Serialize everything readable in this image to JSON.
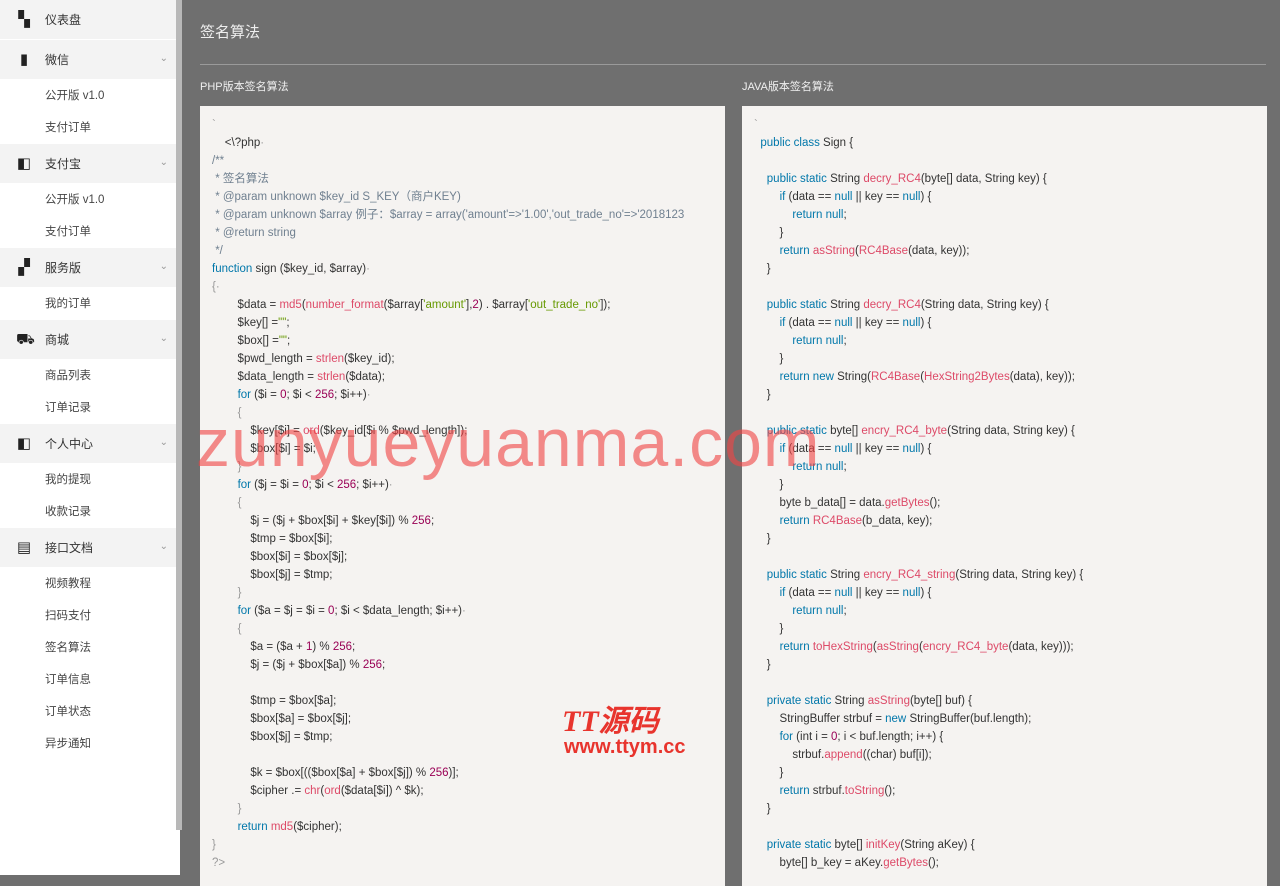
{
  "sidebar": {
    "items": [
      {
        "label": "仪表盘",
        "icon": "dashboard-icon",
        "glyph": "▚",
        "expandable": false
      },
      {
        "label": "微信",
        "icon": "wechat-icon",
        "glyph": "▮",
        "expandable": true
      },
      {
        "label": "公开版 v1.0",
        "sub": true
      },
      {
        "label": "支付订单",
        "sub": true
      },
      {
        "label": "支付宝",
        "icon": "wallet-icon",
        "glyph": "◧",
        "expandable": true
      },
      {
        "label": "公开版 v1.0",
        "sub": true
      },
      {
        "label": "支付订单",
        "sub": true
      },
      {
        "label": "服务版",
        "icon": "grid-icon",
        "glyph": "▞",
        "expandable": true
      },
      {
        "label": "我的订单",
        "sub": true
      },
      {
        "label": "商城",
        "icon": "cart-icon",
        "glyph": "⛟",
        "expandable": true
      },
      {
        "label": "商品列表",
        "sub": true
      },
      {
        "label": "订单记录",
        "sub": true
      },
      {
        "label": "个人中心",
        "icon": "wallet-icon",
        "glyph": "◧",
        "expandable": true
      },
      {
        "label": "我的提现",
        "sub": true
      },
      {
        "label": "收款记录",
        "sub": true
      },
      {
        "label": "接口文档",
        "icon": "docs-icon",
        "glyph": "▤",
        "expandable": true
      },
      {
        "label": "视频教程",
        "sub": true
      },
      {
        "label": "扫码支付",
        "sub": true
      },
      {
        "label": "签名算法",
        "sub": true
      },
      {
        "label": "订单信息",
        "sub": true
      },
      {
        "label": "订单状态",
        "sub": true
      },
      {
        "label": "异步通知",
        "sub": true
      }
    ]
  },
  "page": {
    "title": "签名算法",
    "php_title": "PHP版本签名算法",
    "java_title": "JAVA版本签名算法"
  },
  "php_code": [
    "<span class=\"p\">`</span>",
    "    <\\?php<span class=\"p\">·</span>",
    "<span class=\"c\">/**</span>",
    "<span class=\"c\"> * 签名算法</span>",
    "<span class=\"c\"> * @param unknown $key_id S_KEY（商户KEY)</span>",
    "<span class=\"c\"> * @param unknown $array 例子：$array = array('amount'=>'1.00','out_trade_no'=>'2018123</span>",
    "<span class=\"c\"> * @return string</span>",
    "<span class=\"c\"> */</span>",
    "<span class=\"k\">function</span> sign ($key_id, $array)<span class=\"p\">·</span>",
    "<span class=\"p\">{·</span>",
    "        $data = <span class=\"f\">md5</span>(<span class=\"f\">number_format</span>($array[<span class=\"s\">'amount'</span>],<span class=\"n\">2</span>) . $array[<span class=\"s\">'out_trade_no'</span>]);",
    "        $key[] =<span class=\"s\">\"\"</span>;",
    "        $box[] =<span class=\"s\">\"\"</span>;",
    "        $pwd_length = <span class=\"f\">strlen</span>($key_id);",
    "        $data_length = <span class=\"f\">strlen</span>($data);",
    "        <span class=\"k\">for</span> ($i = <span class=\"n\">0</span>; $i &lt; <span class=\"n\">256</span>; $i++)<span class=\"p\">·</span>",
    "        <span class=\"p\">{</span>",
    "            $key[$i] = <span class=\"f\">ord</span>($key_id[$i % $pwd_length]);",
    "            $box[$i] = $i;",
    "        <span class=\"p\">}</span>",
    "        <span class=\"k\">for</span> ($j = $i = <span class=\"n\">0</span>; $i &lt; <span class=\"n\">256</span>; $i++)<span class=\"p\">·</span>",
    "        <span class=\"p\">{</span>",
    "            $j = ($j + $box[$i] + $key[$i]) % <span class=\"n\">256</span>;",
    "            $tmp = $box[$i];",
    "            $box[$i] = $box[$j];",
    "            $box[$j] = $tmp;",
    "        <span class=\"p\">}</span>",
    "        <span class=\"k\">for</span> ($a = $j = $i = <span class=\"n\">0</span>; $i &lt; $data_length; $i++)<span class=\"p\">·</span>",
    "        <span class=\"p\">{</span>",
    "            $a = ($a + <span class=\"n\">1</span>) % <span class=\"n\">256</span>;",
    "            $j = ($j + $box[$a]) % <span class=\"n\">256</span>;",
    "",
    "            $tmp = $box[$a];",
    "            $box[$a] = $box[$j];",
    "            $box[$j] = $tmp;",
    "",
    "            $k = $box[(($box[$a] + $box[$j]) % <span class=\"n\">256</span>)];",
    "            $cipher .= <span class=\"f\">chr</span>(<span class=\"f\">ord</span>($data[$i]) ^ $k);",
    "        <span class=\"p\">}</span>",
    "        <span class=\"k\">return</span> <span class=\"f\">md5</span>($cipher);",
    "<span class=\"p\">}</span>",
    "<span class=\"p\">?&gt;</span>"
  ],
  "java_code": [
    "<span class=\"p\">`</span>",
    "  <span class=\"k\">public class</span> Sign {",
    "",
    "    <span class=\"k\">public static</span> String <span class=\"f\">decry_RC4</span>(byte[] data, String key) {",
    "        <span class=\"k\">if</span> (data == <span class=\"k\">null</span> || key == <span class=\"k\">null</span>) {",
    "            <span class=\"k\">return null</span>;",
    "        }",
    "        <span class=\"k\">return</span> <span class=\"f\">asString</span>(<span class=\"f\">RC4Base</span>(data, key));",
    "    }",
    "",
    "    <span class=\"k\">public static</span> String <span class=\"f\">decry_RC4</span>(String data, String key) {",
    "        <span class=\"k\">if</span> (data == <span class=\"k\">null</span> || key == <span class=\"k\">null</span>) {",
    "            <span class=\"k\">return null</span>;",
    "        }",
    "        <span class=\"k\">return new</span> String(<span class=\"f\">RC4Base</span>(<span class=\"f\">HexString2Bytes</span>(data), key));",
    "    }",
    "",
    "    <span class=\"k\">public static</span> byte[] <span class=\"f\">encry_RC4_byte</span>(String data, String key) {",
    "        <span class=\"k\">if</span> (data == <span class=\"k\">null</span> || key == <span class=\"k\">null</span>) {",
    "            <span class=\"k\">return null</span>;",
    "        }",
    "        byte b_data[] = data.<span class=\"f\">getBytes</span>();",
    "        <span class=\"k\">return</span> <span class=\"f\">RC4Base</span>(b_data, key);",
    "    }",
    "",
    "    <span class=\"k\">public static</span> String <span class=\"f\">encry_RC4_string</span>(String data, String key) {",
    "        <span class=\"k\">if</span> (data == <span class=\"k\">null</span> || key == <span class=\"k\">null</span>) {",
    "            <span class=\"k\">return null</span>;",
    "        }",
    "        <span class=\"k\">return</span> <span class=\"f\">toHexString</span>(<span class=\"f\">asString</span>(<span class=\"f\">encry_RC4_byte</span>(data, key)));",
    "    }",
    "",
    "    <span class=\"k\">private static</span> String <span class=\"f\">asString</span>(byte[] buf) {",
    "        StringBuffer strbuf = <span class=\"k\">new</span> StringBuffer(buf.length);",
    "        <span class=\"k\">for</span> (int i = <span class=\"n\">0</span>; i &lt; buf.length; i++) {",
    "            strbuf.<span class=\"f\">append</span>((char) buf[i]);",
    "        }",
    "        <span class=\"k\">return</span> strbuf.<span class=\"f\">toString</span>();",
    "    }",
    "",
    "    <span class=\"k\">private static</span> byte[] <span class=\"f\">initKey</span>(String aKey) {",
    "        byte[] b_key = aKey.<span class=\"f\">getBytes</span>();"
  ],
  "watermark": {
    "main": "zunyueyuanma.com",
    "logo": "TT源码",
    "url": "www.ttym.cc"
  }
}
